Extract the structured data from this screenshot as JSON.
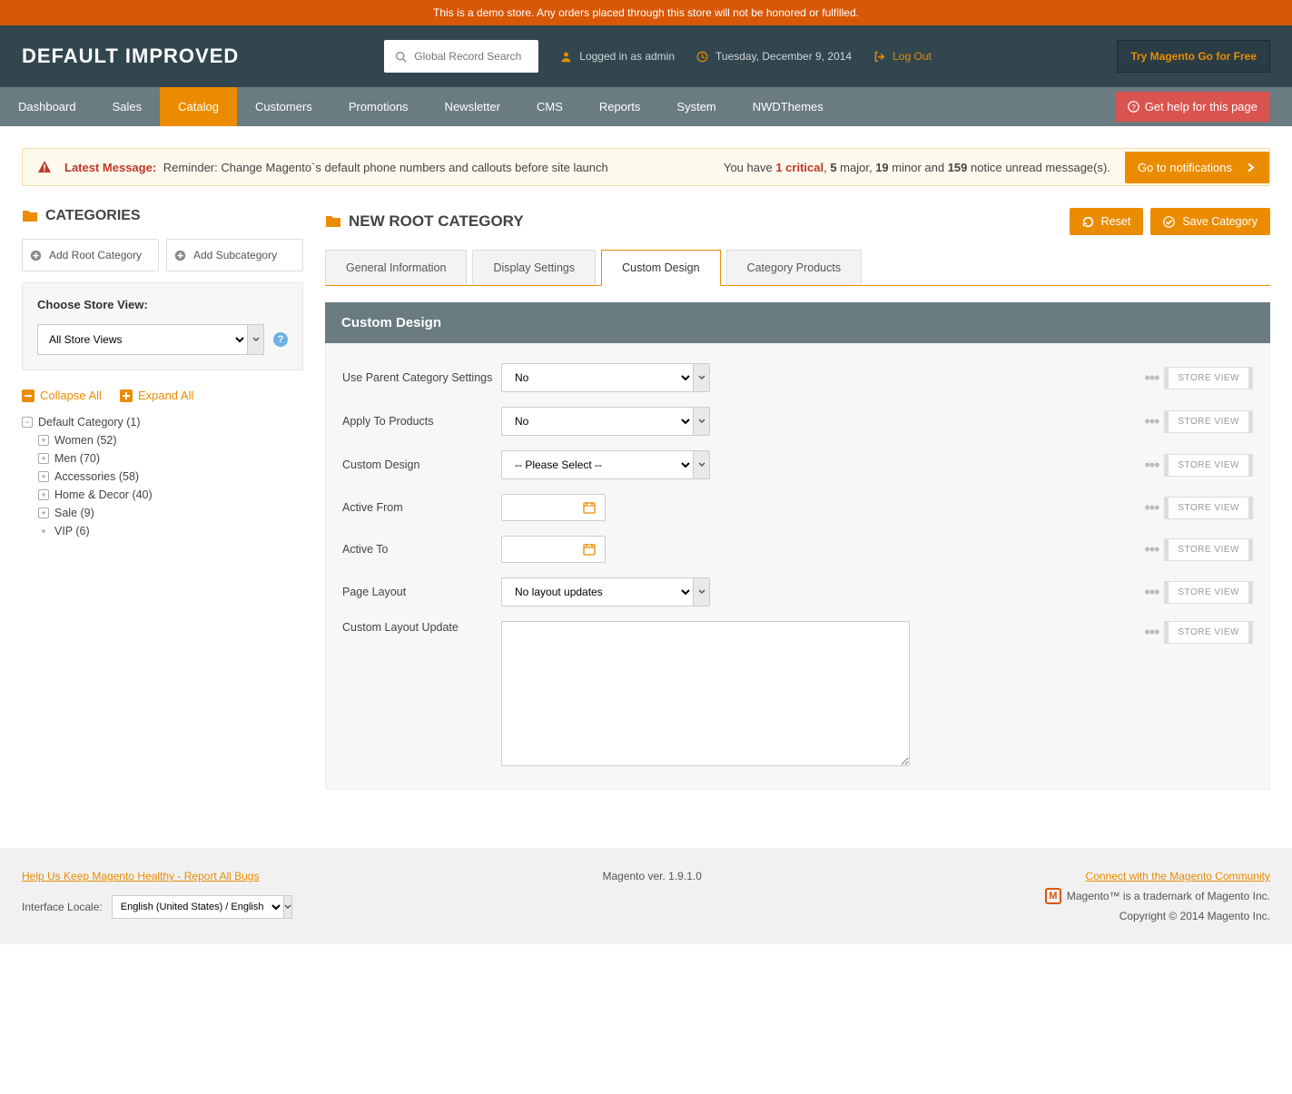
{
  "demo_banner": "This is a demo store. Any orders placed through this store will not be honored or fulfilled.",
  "header": {
    "title": "DEFAULT IMPROVED",
    "search_placeholder": "Global Record Search",
    "logged_in": "Logged in as admin",
    "date": "Tuesday, December 9, 2014",
    "logout": "Log Out",
    "try": "Try Magento Go for Free"
  },
  "nav": {
    "items": [
      "Dashboard",
      "Sales",
      "Catalog",
      "Customers",
      "Promotions",
      "Newsletter",
      "CMS",
      "Reports",
      "System",
      "NWDThemes"
    ],
    "active": "Catalog",
    "help": "Get help for this page"
  },
  "message": {
    "latest_label": "Latest Message:",
    "reminder": "Reminder: Change Magento`s default phone numbers and callouts before site launch",
    "counts_pre": "You have ",
    "critical": "1 critical",
    "major": "5",
    "major_txt": " major, ",
    "minor": "19",
    "minor_txt": " minor and ",
    "notice": "159",
    "notice_txt": " notice unread message(s).",
    "go": "Go to notifications"
  },
  "sidebar": {
    "title": "CATEGORIES",
    "add_root": "Add Root Category",
    "add_sub": "Add Subcategory",
    "choose_store": "Choose Store View:",
    "store_value": "All Store Views",
    "collapse": "Collapse All",
    "expand": "Expand All",
    "tree": {
      "root": "Default Category (1)",
      "children": [
        "Women (52)",
        "Men (70)",
        "Accessories (58)",
        "Home & Decor (40)",
        "Sale (9)",
        "VIP (6)"
      ]
    }
  },
  "content": {
    "title": "NEW ROOT CATEGORY",
    "reset": "Reset",
    "save": "Save Category",
    "tabs": [
      "General Information",
      "Display Settings",
      "Custom Design",
      "Category Products"
    ],
    "active_tab": "Custom Design",
    "panel_title": "Custom Design",
    "fields": {
      "use_parent": {
        "label": "Use Parent Category Settings",
        "value": "No"
      },
      "apply_products": {
        "label": "Apply To Products",
        "value": "No"
      },
      "custom_design": {
        "label": "Custom Design",
        "value": "-- Please Select --"
      },
      "active_from": {
        "label": "Active From",
        "value": ""
      },
      "active_to": {
        "label": "Active To",
        "value": ""
      },
      "page_layout": {
        "label": "Page Layout",
        "value": "No layout updates"
      },
      "layout_update": {
        "label": "Custom Layout Update",
        "value": ""
      }
    },
    "scope": "STORE VIEW"
  },
  "footer": {
    "bugs": "Help Us Keep Magento Healthy - Report All Bugs",
    "locale_label": "Interface Locale:",
    "locale_value": "English (United States) / English",
    "version": "Magento ver. 1.9.1.0",
    "community": "Connect with the Magento Community",
    "trademark": "Magento™ is a trademark of Magento Inc.",
    "copyright": "Copyright © 2014 Magento Inc."
  }
}
